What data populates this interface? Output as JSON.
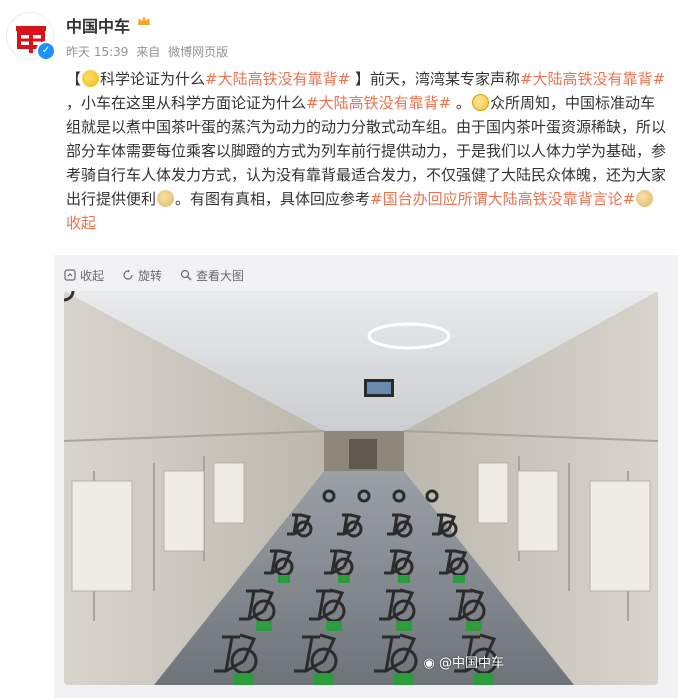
{
  "header": {
    "username": "中国中车",
    "time": "昨天 15:39",
    "source_prefix": "来自",
    "source": "微博网页版"
  },
  "post": {
    "bracket_open": "【",
    "title": "科学论证为什么",
    "tag1": "#大陆高铁没有靠背#",
    "bracket_close": " 】",
    "p1": "前天，湾湾某专家声称",
    "tag2": "#大陆高铁没有靠背#",
    "p2": " ，小车在这里从科学方面论证为什么",
    "tag3": "#大陆高铁没有靠背#",
    "p3": " 。",
    "p4": "众所周知，中国标准动车组就是以煮中国茶叶蛋的蒸汽为动力的动力分散式动车组。由于国内茶叶蛋资源稀缺，所以部分车体需要每位乘客以脚蹬的方式为列车前行提供动力，于是我们以人体力学为基础，参考骑自行车人体发力方式，认为没有靠背最适合发力，不仅强健了大陆民众体魄，还为大家出行提供便利",
    "p5": "。有图有真相，具体回应参考",
    "tag4": "#国台办回应所谓大陆高铁没靠背言论#",
    "fold": "收起"
  },
  "media": {
    "collapse_label": "收起",
    "rotate_label": "旋转",
    "view_large_label": "查看大图",
    "watermark": "@中国中车"
  },
  "colors": {
    "link": "#eb7350",
    "meta": "#939393",
    "text": "#333333",
    "verified": "#1e90ff"
  },
  "icons": [
    "crrc-logo-icon",
    "verified-icon",
    "crown-icon",
    "think-emoji-icon",
    "glasses-emoji-icon",
    "doge-emoji-icon",
    "collapse-icon",
    "rotate-icon",
    "view-large-icon",
    "weibo-icon"
  ]
}
